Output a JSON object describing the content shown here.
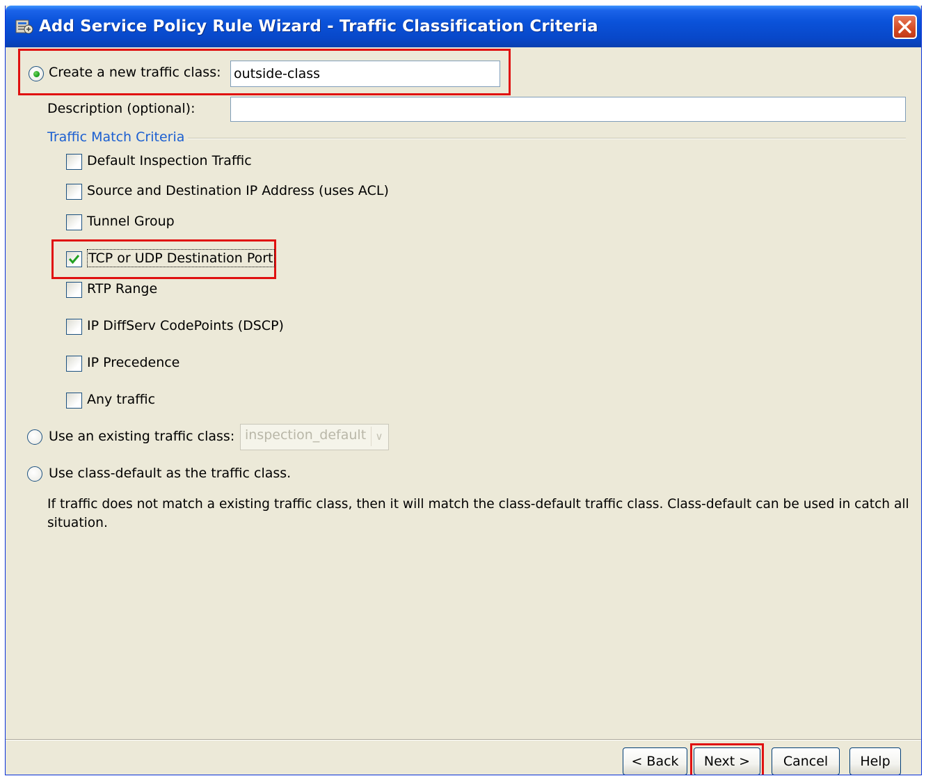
{
  "window": {
    "title": "Add Service Policy Rule Wizard - Traffic Classification Criteria",
    "icon": "asdm-app-icon"
  },
  "new_class": {
    "label": "Create a new traffic class:",
    "value": "outside-class",
    "selected": true
  },
  "description": {
    "label": "Description (optional):",
    "value": ""
  },
  "criteria": {
    "title": "Traffic Match Criteria",
    "items": [
      {
        "label": "Default Inspection Traffic",
        "checked": false
      },
      {
        "label": "Source and Destination IP Address (uses ACL)",
        "checked": false
      },
      {
        "label": "Tunnel Group",
        "checked": false
      },
      {
        "label": "TCP or UDP Destination Port",
        "checked": true
      },
      {
        "label": "RTP Range",
        "checked": false
      },
      {
        "label": "IP DiffServ CodePoints (DSCP)",
        "checked": false
      },
      {
        "label": "IP Precedence",
        "checked": false
      },
      {
        "label": "Any traffic",
        "checked": false
      }
    ]
  },
  "existing_class": {
    "label": "Use an existing traffic class:",
    "selected_value": "inspection_default",
    "selected": false
  },
  "class_default": {
    "label": "Use class-default as the traffic class.",
    "selected": false
  },
  "info_text": {
    "line1": "If traffic does not match a existing traffic class, then it will match the class-default traffic class. Class-default can be used in catch all",
    "line2": "situation."
  },
  "buttons": {
    "back": "< Back",
    "next": "Next >",
    "cancel": "Cancel",
    "help": "Help"
  },
  "colors": {
    "titlebar": "#0a52d9",
    "dialog_bg": "#ece9d8",
    "highlight_red": "#e01010",
    "group_title": "#1b5fd1"
  }
}
